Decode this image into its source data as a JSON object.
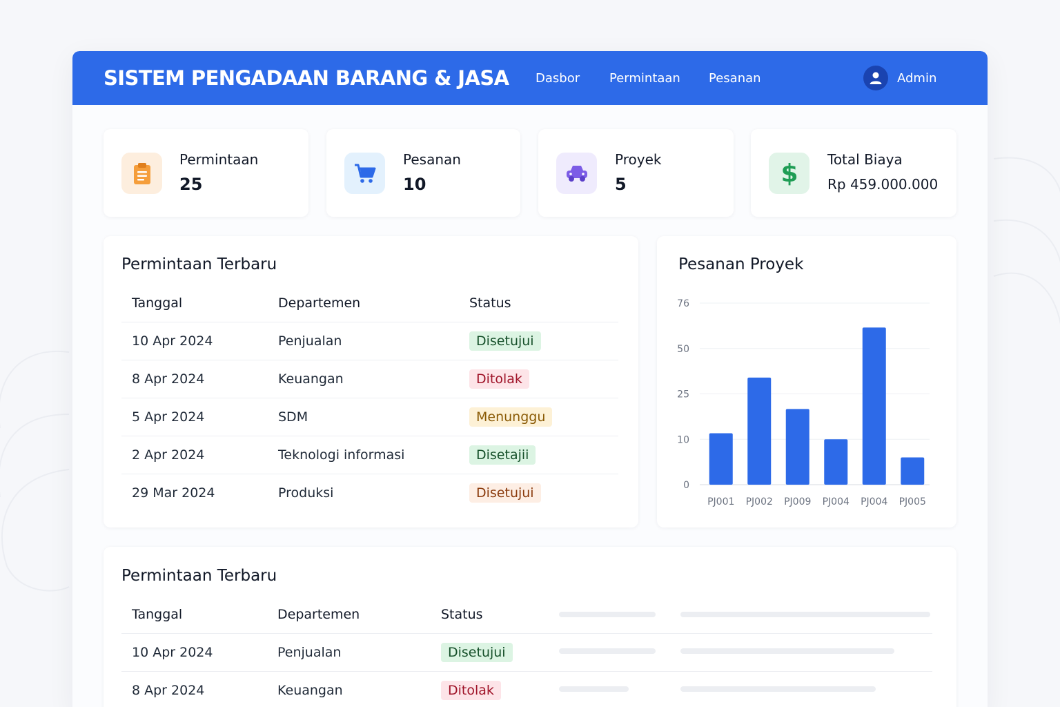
{
  "header": {
    "brand": "SISTEM PENGADAAN BARANG & JASA",
    "nav": [
      "Dasbor",
      "Permintaan",
      "Pesanan"
    ],
    "user": "Admin",
    "color": "#2d6ae8"
  },
  "stats": [
    {
      "label": "Permintaan",
      "value": "25",
      "icon": "clipboard-icon",
      "color": "#f59e3b"
    },
    {
      "label": "Pesanan",
      "value": "10",
      "icon": "cart-icon",
      "color": "#2d6ae8"
    },
    {
      "label": "Proyek",
      "value": "5",
      "icon": "car-icon",
      "color": "#7c5ce6"
    },
    {
      "label": "Total Biaya",
      "value": "Rp 459.000.000",
      "icon": "dollar-icon",
      "color": "#1f9d55"
    }
  ],
  "recent": {
    "title": "Permintaan Terbaru",
    "columns": [
      "Tanggal",
      "Departemen",
      "Status"
    ],
    "rows": [
      {
        "date": "10 Apr 2024",
        "dept": "Penjualan",
        "status": "Disetujui",
        "tone": "green"
      },
      {
        "date": "8 Apr 2024",
        "dept": "Keuangan",
        "status": "Ditolak",
        "tone": "red"
      },
      {
        "date": "5 Apr 2024",
        "dept": "SDM",
        "status": "Menunggu",
        "tone": "yellow"
      },
      {
        "date": "2 Apr 2024",
        "dept": "Teknologi informasi",
        "status": "Disetajii",
        "tone": "green"
      },
      {
        "date": "29 Mar 2024",
        "dept": "Produksi",
        "status": "Disetujui",
        "tone": "orange"
      }
    ]
  },
  "chart": {
    "title": "Pesanan Proyek"
  },
  "chart_data": {
    "type": "bar",
    "categories": [
      "PJ001",
      "PJ002",
      "PJ009",
      "PJ004",
      "PJ004",
      "PJ005"
    ],
    "values": [
      12,
      34,
      20,
      10,
      62,
      6
    ],
    "yticks": [
      0,
      10,
      25,
      50,
      76
    ],
    "ylim": [
      0,
      76
    ],
    "grid": true,
    "color": "#2d6ae8"
  },
  "recent2": {
    "title": "Permintaan Terbaru",
    "columns": [
      "Tanggal",
      "Departemen",
      "Status"
    ],
    "rows": [
      {
        "date": "10 Apr 2024",
        "dept": "Penjualan",
        "status": "Disetujui",
        "tone": "green"
      },
      {
        "date": "8 Apr 2024",
        "dept": "Keuangan",
        "status": "Ditolak",
        "tone": "red"
      }
    ]
  }
}
